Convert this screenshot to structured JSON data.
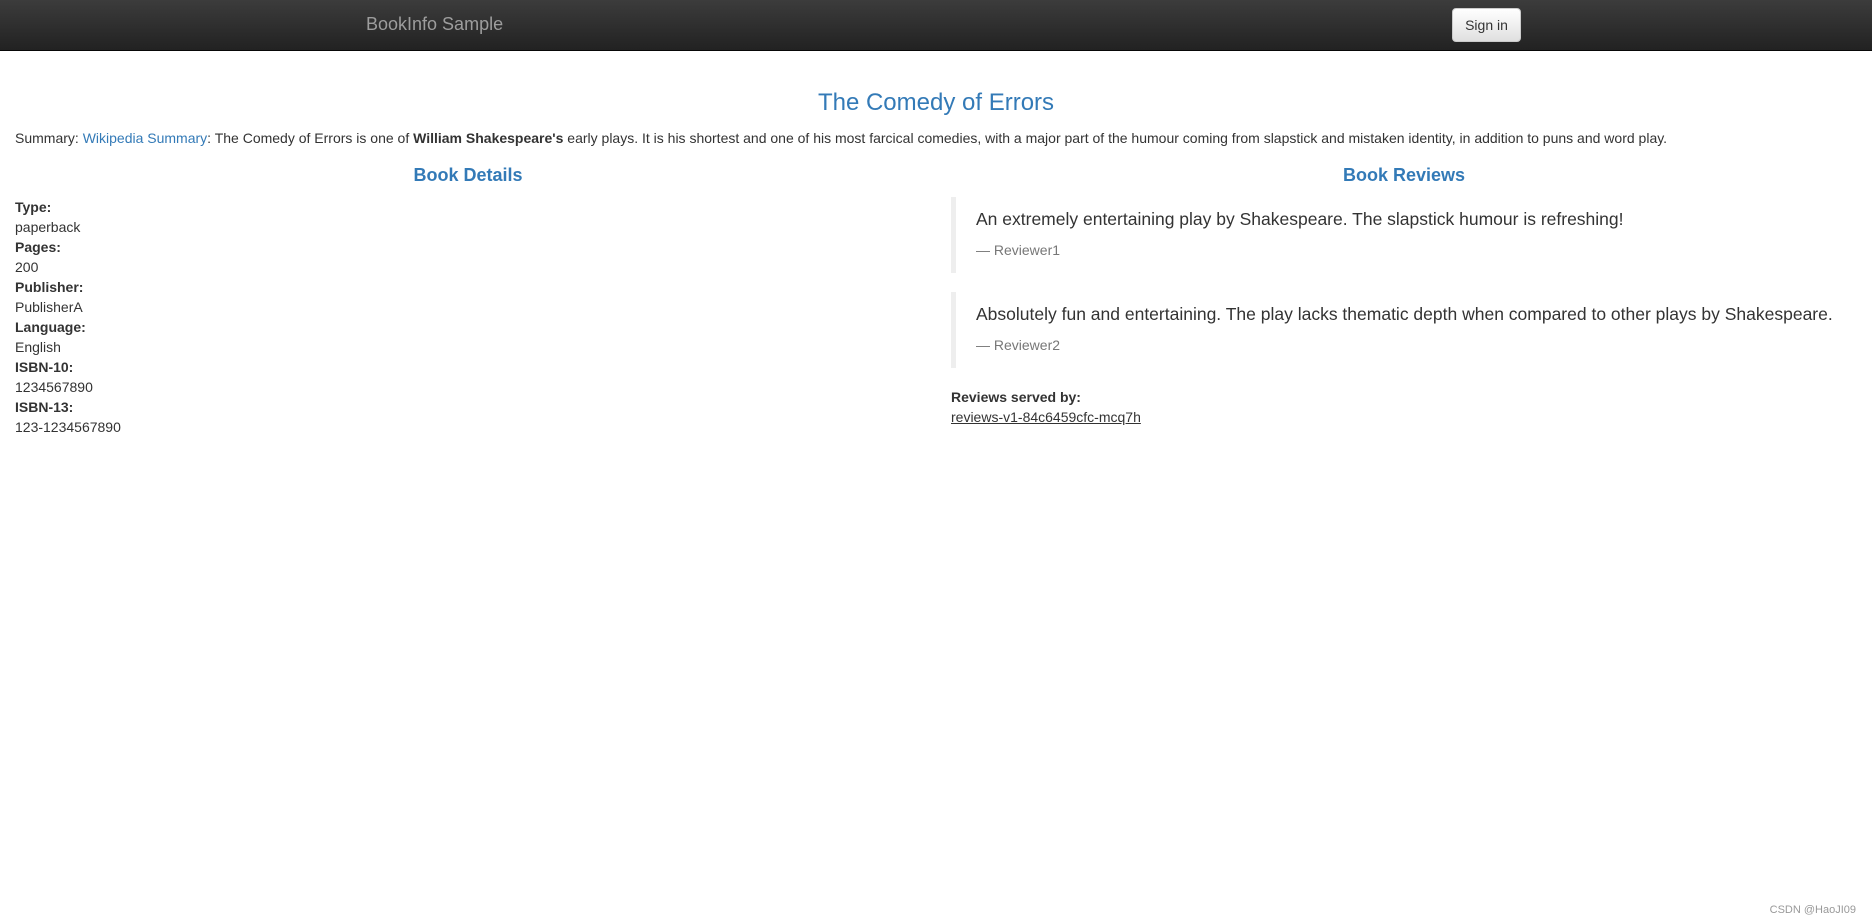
{
  "navbar": {
    "brand": "BookInfo Sample",
    "sign_in_label": "Sign in"
  },
  "book": {
    "title": "The Comedy of Errors",
    "summary_label": "Summary:",
    "wikipedia_link": "Wikipedia Summary",
    "summary_text_1": ": The Comedy of Errors is one of ",
    "summary_bold": "William Shakespeare's",
    "summary_text_2": " early plays. It is his shortest and one of his most farcical comedies, with a major part of the humour coming from slapstick and mistaken identity, in addition to puns and word play."
  },
  "details": {
    "heading": "Book Details",
    "fields": [
      {
        "label": "Type:",
        "value": "paperback"
      },
      {
        "label": "Pages:",
        "value": "200"
      },
      {
        "label": "Publisher:",
        "value": "PublisherA"
      },
      {
        "label": "Language:",
        "value": "English"
      },
      {
        "label": "ISBN-10:",
        "value": "1234567890"
      },
      {
        "label": "ISBN-13:",
        "value": "123-1234567890"
      }
    ]
  },
  "reviews": {
    "heading": "Book Reviews",
    "items": [
      {
        "text": "An extremely entertaining play by Shakespeare. The slapstick humour is refreshing!",
        "reviewer": "— Reviewer1"
      },
      {
        "text": "Absolutely fun and entertaining. The play lacks thematic depth when compared to other plays by Shakespeare.",
        "reviewer": "— Reviewer2"
      }
    ],
    "served_by_label": "Reviews served by:",
    "served_by_value": "reviews-v1-84c6459cfc-mcq7h"
  },
  "watermark": "CSDN @HaoJI09"
}
